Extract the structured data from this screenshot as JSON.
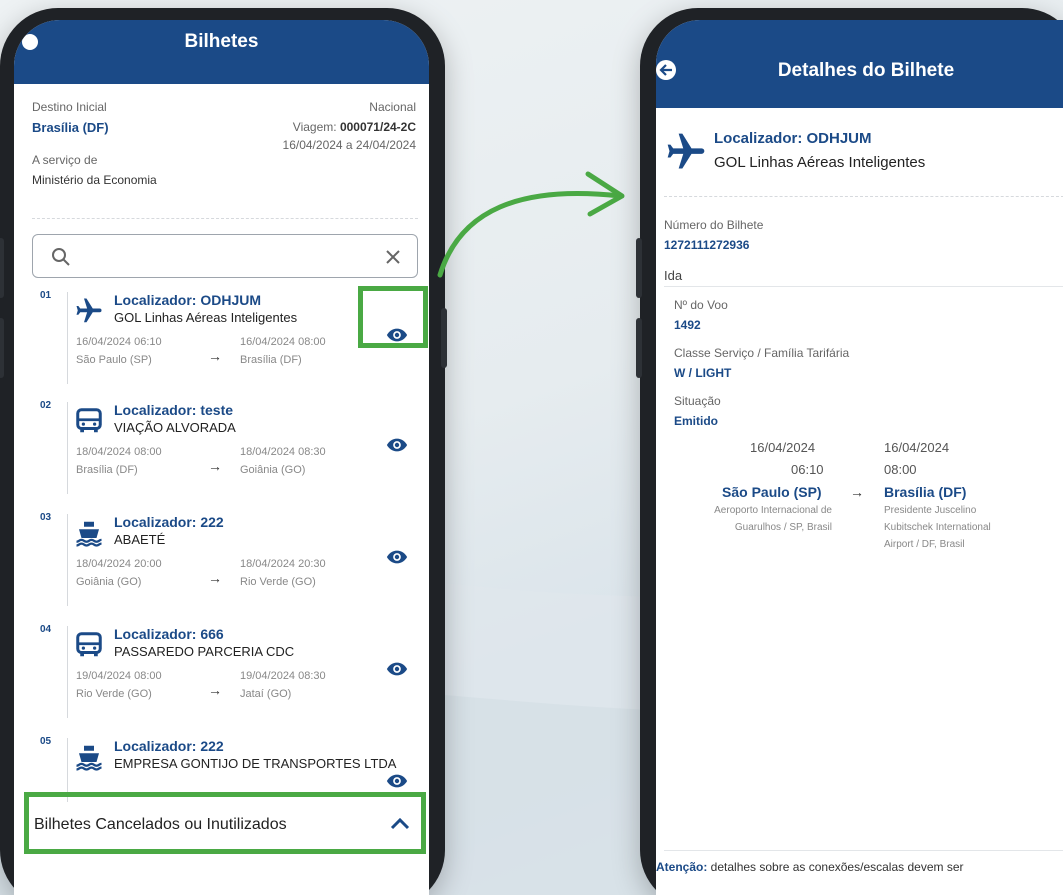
{
  "left": {
    "title": "Bilhetes",
    "destino_label": "Destino Inicial",
    "destino_value": "Brasília (DF)",
    "tipo": "Nacional",
    "viagem_label": "Viagem:",
    "viagem_value": "000071/24-2C",
    "periodo": "16/04/2024 a 24/04/2024",
    "servico_label": "A serviço de",
    "servico_value": "Ministério da Economia",
    "search_placeholder": "",
    "tickets": [
      {
        "num": "01",
        "icon": "airplane-icon",
        "loc": "Localizador: ODHJUM",
        "comp": "GOL Linhas Aéreas Inteligentes",
        "d1": "16/04/2024 06:10",
        "c1": "São Paulo (SP)",
        "d2": "16/04/2024 08:00",
        "c2": "Brasília (DF)"
      },
      {
        "num": "02",
        "icon": "bus-icon",
        "loc": "Localizador: teste",
        "comp": "VIAÇÃO ALVORADA",
        "d1": "18/04/2024 08:00",
        "c1": "Brasília (DF)",
        "d2": "18/04/2024 08:30",
        "c2": "Goiânia (GO)"
      },
      {
        "num": "03",
        "icon": "ship-icon",
        "loc": "Localizador: 222",
        "comp": "ABAETÉ",
        "d1": "18/04/2024 20:00",
        "c1": "Goiânia (GO)",
        "d2": "18/04/2024 20:30",
        "c2": "Rio Verde (GO)"
      },
      {
        "num": "04",
        "icon": "bus-icon",
        "loc": "Localizador: 666",
        "comp": "PASSAREDO PARCERIA CDC",
        "d1": "19/04/2024 08:00",
        "c1": "Rio Verde (GO)",
        "d2": "19/04/2024 08:30",
        "c2": "Jataí (GO)"
      },
      {
        "num": "05",
        "icon": "ship-icon",
        "loc": "Localizador: 222",
        "comp": "EMPRESA GONTIJO DE TRANSPORTES LTDA",
        "d1": "",
        "c1": "",
        "d2": "",
        "c2": ""
      }
    ],
    "cancelados": "Bilhetes Cancelados ou Inutilizados"
  },
  "right": {
    "title": "Detalhes do Bilhete",
    "loc": "Localizador:  ODHJUM",
    "comp": "GOL Linhas Aéreas Inteligentes",
    "numero_label": "Número do Bilhete",
    "numero_value": "1272111272936",
    "ida": "Ida",
    "voo_label": "Nº do Voo",
    "voo_value": "1492",
    "classe_label": "Classe Serviço / Família Tarifária",
    "classe_value": "W / LIGHT",
    "situacao_label": "Situação",
    "situacao_value": "Emitido",
    "origem": {
      "date": "16/04/2024",
      "time": "06:10",
      "city": "São Paulo (SP)",
      "airport1": "Aeroporto Internacional de",
      "airport2": "Guarulhos / SP, Brasil"
    },
    "destino": {
      "date": "16/04/2024",
      "time": "08:00",
      "city": "Brasília (DF)",
      "airport1": "Presidente Juscelino",
      "airport2": "Kubitschek International",
      "airport3": "Airport / DF, Brasil"
    },
    "attn_bold": "Atenção:",
    "attn_text": " detalhes sobre as conexões/escalas devem ser"
  },
  "colors": {
    "primary": "#1b4a87",
    "highlight": "#4aa944",
    "background": "#e9eff2"
  }
}
